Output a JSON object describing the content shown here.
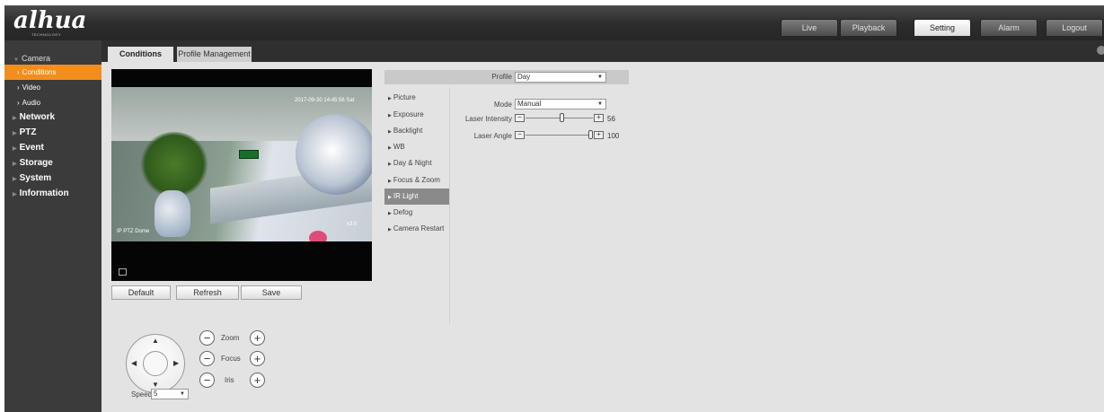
{
  "header": {
    "logo_text": "alhua",
    "logo_sub": "TECHNOLOGY",
    "nav": [
      {
        "label": "Live",
        "active": false
      },
      {
        "label": "Playback",
        "active": false
      },
      {
        "label": "Setting",
        "active": true
      },
      {
        "label": "Alarm",
        "active": false
      },
      {
        "label": "Logout",
        "active": false
      }
    ]
  },
  "sidebar": {
    "items": [
      {
        "label": "Camera",
        "type": "cat-open"
      },
      {
        "label": "Conditions",
        "type": "sub",
        "selected": true
      },
      {
        "label": "Video",
        "type": "sub"
      },
      {
        "label": "Audio",
        "type": "sub"
      },
      {
        "label": "Network",
        "type": "cat"
      },
      {
        "label": "PTZ",
        "type": "cat"
      },
      {
        "label": "Event",
        "type": "cat"
      },
      {
        "label": "Storage",
        "type": "cat"
      },
      {
        "label": "System",
        "type": "cat"
      },
      {
        "label": "Information",
        "type": "cat"
      }
    ]
  },
  "tabs": {
    "conditions": "Conditions",
    "profile_management": "Profile Management"
  },
  "video": {
    "osd_time": "2017-09-30 14:45:56 Sat",
    "osd_name": "IP PTZ Dome",
    "osd_zoom": "x3.0"
  },
  "buttons": {
    "default": "Default",
    "refresh": "Refresh",
    "save": "Save"
  },
  "ptz": {
    "zoom": "Zoom",
    "focus": "Focus",
    "iris": "Iris",
    "speed_label": "Speed",
    "speed_value": "5",
    "minus": "−",
    "plus": "+"
  },
  "profile": {
    "label": "Profile",
    "value": "Day"
  },
  "menu": [
    {
      "label": "Picture",
      "selected": false
    },
    {
      "label": "Exposure",
      "selected": false
    },
    {
      "label": "Backlight",
      "selected": false
    },
    {
      "label": "WB",
      "selected": false
    },
    {
      "label": "Day & Night",
      "selected": false
    },
    {
      "label": "Focus & Zoom",
      "selected": false
    },
    {
      "label": "IR Light",
      "selected": true
    },
    {
      "label": "Defog",
      "selected": false
    },
    {
      "label": "Camera Restart",
      "selected": false
    }
  ],
  "ir_light": {
    "mode_label": "Mode",
    "mode_value": "Manual",
    "laser_intensity_label": "Laser Intensity",
    "laser_intensity_value": "56",
    "laser_intensity_fraction": 0.56,
    "laser_angle_label": "Laser Angle",
    "laser_angle_value": "100",
    "laser_angle_fraction": 1.0
  },
  "colors": {
    "accent": "#f28e1c",
    "sidebar_bg": "#3b3b3b",
    "content_bg": "#e3e3e3"
  }
}
